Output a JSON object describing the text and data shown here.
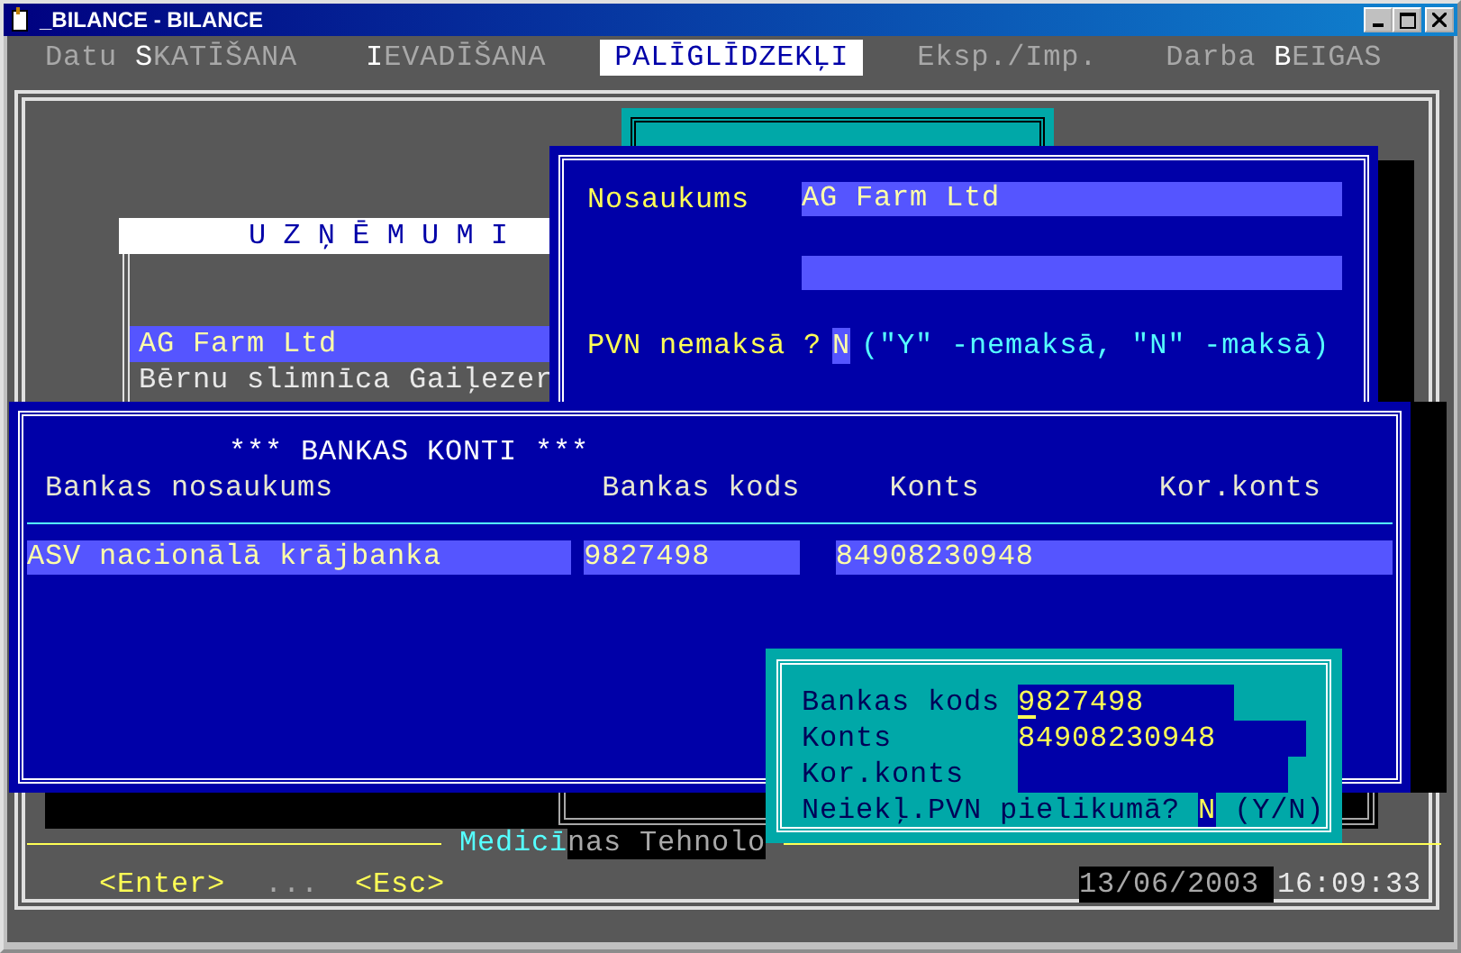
{
  "window": {
    "title": "_BILANCE - BILANCE"
  },
  "menu": [
    {
      "before": "Datu ",
      "hotkey": "S",
      "after": "KATĪŠANA",
      "selected": false
    },
    {
      "hotkey": "I",
      "after": "EVADĪŠANA",
      "selected": false
    },
    {
      "after": "PALĪGLĪDZEKĻI",
      "selected": true
    },
    {
      "before": "Eksp./Imp.",
      "selected": false
    },
    {
      "before": "Darba ",
      "hotkey": "B",
      "after": "EIGAS",
      "selected": false
    }
  ],
  "companies": {
    "title": "U Z Ņ Ē M U M I",
    "items": [
      {
        "name": "AG Farm Ltd",
        "selected": true
      },
      {
        "name": "Bērnu slimnīca Gaiļezer",
        "selected": false
      }
    ]
  },
  "company_form": {
    "name": {
      "label": "Nosaukums",
      "value": "AG Farm Ltd"
    },
    "vat": {
      "label": "PVN nemaksā ?",
      "value": "N",
      "hint": "(\"Y\" -nemaksā, \"N\" -maksā)"
    }
  },
  "bank_accounts": {
    "title": "*** BANKAS KONTI ***",
    "columns": [
      "Bankas nosaukums",
      "Bankas kods",
      "Konts",
      "Kor.konts"
    ],
    "rows": [
      [
        "ASV nacionālā krājbanka",
        "9827498",
        "84908230948"
      ]
    ]
  },
  "edit_dialog": {
    "fields": [
      {
        "label": "Bankas kods",
        "value": "9827498"
      },
      {
        "label": "Konts",
        "value": "84908230948"
      },
      {
        "label": "Kor.konts"
      }
    ],
    "vat": {
      "label": "Neiekļ.PVN pielikumā?",
      "value": "N",
      "hint": "(Y/N)"
    }
  },
  "status": {
    "highlight": "Medicī",
    "rest": "nas Tehnolo",
    "keys": [
      "<Enter>",
      "...",
      "<Esc>"
    ],
    "date": "13/06/2003",
    "time": "16:09:33"
  }
}
